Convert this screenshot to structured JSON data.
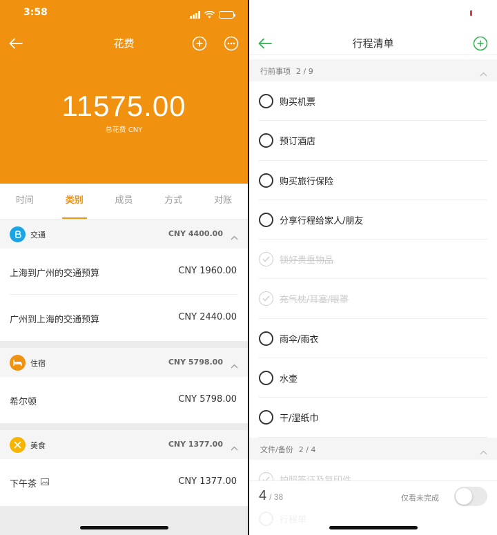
{
  "left": {
    "status": {
      "time": "3:58"
    },
    "nav": {
      "title": "花费"
    },
    "summary": {
      "amount": "11575.00",
      "label": "总花费 CNY"
    },
    "tabs": [
      {
        "label": "时间",
        "active": false
      },
      {
        "label": "类别",
        "active": true
      },
      {
        "label": "成员",
        "active": false
      },
      {
        "label": "方式",
        "active": false
      },
      {
        "label": "对账",
        "active": false
      }
    ],
    "categories": [
      {
        "name": "交通",
        "icon": "transport-icon",
        "color": "#1aa6e6",
        "total": "CNY 4400.00",
        "items": [
          {
            "name": "上海到广州的交通预算",
            "amount": "CNY 1960.00"
          },
          {
            "name": "广州到上海的交通预算",
            "amount": "CNY 2440.00"
          }
        ]
      },
      {
        "name": "住宿",
        "icon": "bed-icon",
        "color": "#f0920f",
        "total": "CNY 5798.00",
        "items": [
          {
            "name": "希尔顿",
            "amount": "CNY 5798.00"
          }
        ]
      },
      {
        "name": "美食",
        "icon": "utensils-icon",
        "color": "#f7b500",
        "total": "CNY 1377.00",
        "items": [
          {
            "name": "下午茶",
            "amount": "CNY 1377.00",
            "has_image_icon": true
          }
        ]
      }
    ]
  },
  "right": {
    "nav": {
      "title": "行程清单"
    },
    "accent": "#2bb24c",
    "sections": [
      {
        "title": "行前事项",
        "count": "2 / 9",
        "items": [
          {
            "label": "购买机票",
            "done": false
          },
          {
            "label": "预订酒店",
            "done": false
          },
          {
            "label": "购买旅行保险",
            "done": false
          },
          {
            "label": "分享行程给家人/朋友",
            "done": false
          },
          {
            "label": "锁好贵重物品",
            "done": true
          },
          {
            "label": "充气枕/耳塞/眼罩",
            "done": true
          },
          {
            "label": "雨伞/雨衣",
            "done": false
          },
          {
            "label": "水壶",
            "done": false
          },
          {
            "label": "干/湿纸巾",
            "done": false
          }
        ]
      },
      {
        "title": "文件/备份",
        "count": "2 / 4",
        "items": [
          {
            "label": "护照签证及复印件",
            "done": true
          },
          {
            "label": "行程单",
            "done": false
          }
        ]
      }
    ],
    "footer": {
      "done_count": "4",
      "total_count": "/ 38",
      "toggle_label": "仅看未完成",
      "toggle_on": false
    }
  }
}
